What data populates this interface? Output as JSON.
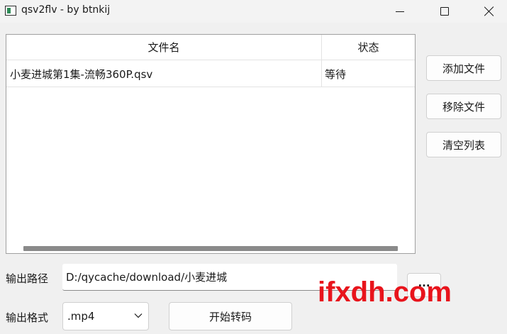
{
  "window": {
    "title": "qsv2flv - by btnkij",
    "icons": {
      "app": "app-icon",
      "minimize": "minimize-icon",
      "maximize": "maximize-icon",
      "close": "close-icon"
    }
  },
  "file_list": {
    "columns": [
      "文件名",
      "状态"
    ],
    "rows": [
      {
        "name": "小麦进城第1集-流畅360P.qsv",
        "status": "等待"
      }
    ]
  },
  "sidebar": {
    "add_label": "添加文件",
    "remove_label": "移除文件",
    "clear_label": "清空列表"
  },
  "output": {
    "path_label": "输出路径",
    "path_value": "D:/qycache/download/小麦进城",
    "browse_label": "...",
    "format_label": "输出格式",
    "format_value": ".mp4",
    "start_label": "开始转码"
  },
  "watermark": {
    "text": "ifxdh.com",
    "color": "#e8141c"
  }
}
